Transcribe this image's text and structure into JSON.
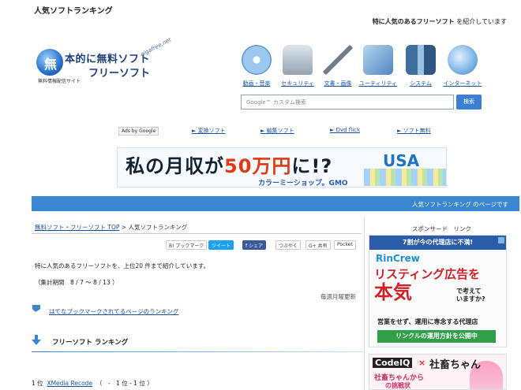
{
  "header": {
    "site_title": "人気ソフトランキング",
    "tagline_bold": "特に人気のあるフリーソフト",
    "tagline_rest": " を紹介しています"
  },
  "logo": {
    "mark": "無",
    "line1": "本的に無料ソフト",
    "line2": "フリーソフト",
    "domain": "gigafree.net",
    "sub": "無料情報配信サイト"
  },
  "categories": [
    {
      "label": "動画・音楽",
      "icon": "media-disc-icon",
      "color": "#9cc7ee"
    },
    {
      "label": "セキュリティ",
      "icon": "padlock-icon",
      "color": "#b9c4cf"
    },
    {
      "label": "文書・画像",
      "icon": "pen-icon",
      "color": "#d7dde4"
    },
    {
      "label": "ユーティリティ",
      "icon": "tools-icon",
      "color": "#7fb2de"
    },
    {
      "label": "システム",
      "icon": "system-icon",
      "color": "#5e86b3"
    },
    {
      "label": "インターネット",
      "icon": "globe-icon",
      "color": "#8fbfe8"
    }
  ],
  "search": {
    "placeholder": "Google™ カスタム検索",
    "button": "検索"
  },
  "ad_links": {
    "ads_by": "Ads by Google",
    "links": [
      "► 変換ソフト",
      "► 編集ソフト",
      "► Dvd flick",
      "► ソフト無料"
    ]
  },
  "banner": {
    "text_a": "私の月収が",
    "text_red": "50万円",
    "text_b": "に!?",
    "usa": "USA",
    "sub": "カラーミーショップ。GMO"
  },
  "bluebar": "人気ソフトランキング のページです",
  "breadcrumb": {
    "home": "無料ソフト・フリーソフト TOP",
    "sep": " > ",
    "current": "人気ソフトランキング"
  },
  "share": {
    "bookmark": "B! ブックマーク",
    "tweet": "ツイート",
    "facebook": "f シェア",
    "tsubuyaku": "つぶやく",
    "kyouyu": "G+ 共有",
    "pocket": "Pocket"
  },
  "content": {
    "intro": "特に人気のあるフリーソフトを、上位20 件まで紹介しています。",
    "period": "（集計期間　8 / 7 ～ 8 / 13 ）",
    "weekly": "毎週月曜更新",
    "hatena_link": "はてなブックマークされてるページのランキング",
    "section_title": "フリーソフト ランキング",
    "rank_no": "1 位",
    "rank_name": "XMedia Recode",
    "rank_detail": "（　-　1 位 - 1 位 ）"
  },
  "sidebar": {
    "sponsor": "スポンサード　リンク",
    "ad1": {
      "top": "7割が今の代理店に不満!",
      "brand": "RinCrew",
      "big1": "リスティング広告を",
      "big2": "本気",
      "question": "で考えて\nいますか?",
      "sub": "営業をせず、運用に専念する代理店",
      "button": "リンクルの運用方針を公開中"
    },
    "ad2": {
      "t1": "CodeIQ",
      "x": "×",
      "t2": "社畜ちゃん",
      "t3": "社畜ちゃんから",
      "t4": "の挑戦状"
    }
  }
}
